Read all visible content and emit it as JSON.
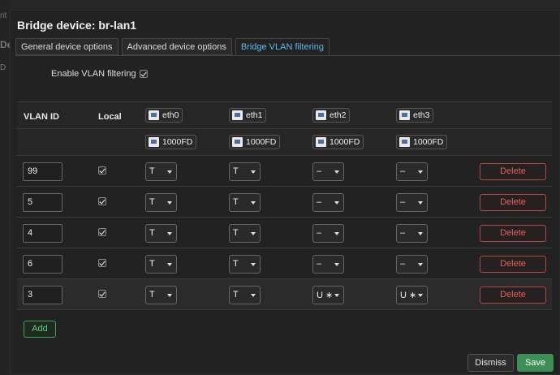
{
  "background": {
    "partial_texts": [
      "nt",
      "De",
      "D"
    ]
  },
  "modal": {
    "title": "Bridge device: br-lan1",
    "tabs": [
      {
        "label": "General device options",
        "active": false
      },
      {
        "label": "Advanced device options",
        "active": false
      },
      {
        "label": "Bridge VLAN filtering",
        "active": true
      }
    ],
    "enable_vlan_filtering": {
      "label": "Enable VLAN filtering",
      "checked": true
    },
    "table": {
      "headers": {
        "vlan_id": "VLAN ID",
        "local": "Local"
      },
      "ports": [
        {
          "name": "eth0",
          "speed": "1000FD"
        },
        {
          "name": "eth1",
          "speed": "1000FD"
        },
        {
          "name": "eth2",
          "speed": "1000FD"
        },
        {
          "name": "eth3",
          "speed": "1000FD"
        }
      ],
      "rows": [
        {
          "vlan_id": "99",
          "local": true,
          "ports": [
            "T",
            "T",
            "–",
            "–"
          ],
          "delete_label": "Delete"
        },
        {
          "vlan_id": "5",
          "local": true,
          "ports": [
            "T",
            "T",
            "–",
            "–"
          ],
          "delete_label": "Delete"
        },
        {
          "vlan_id": "4",
          "local": true,
          "ports": [
            "T",
            "T",
            "–",
            "–"
          ],
          "delete_label": "Delete"
        },
        {
          "vlan_id": "6",
          "local": true,
          "ports": [
            "T",
            "T",
            "–",
            "–"
          ],
          "delete_label": "Delete"
        },
        {
          "vlan_id": "3",
          "local": true,
          "ports": [
            "T",
            "T",
            "U ∗",
            "U ∗"
          ],
          "delete_label": "Delete"
        }
      ]
    },
    "add_label": "Add",
    "dismiss_label": "Dismiss",
    "save_label": "Save"
  },
  "colors": {
    "accent_tab": "#5fb8f0",
    "delete": "#e06060",
    "add": "#5fcf7f",
    "save_bg": "#3e8e58"
  }
}
